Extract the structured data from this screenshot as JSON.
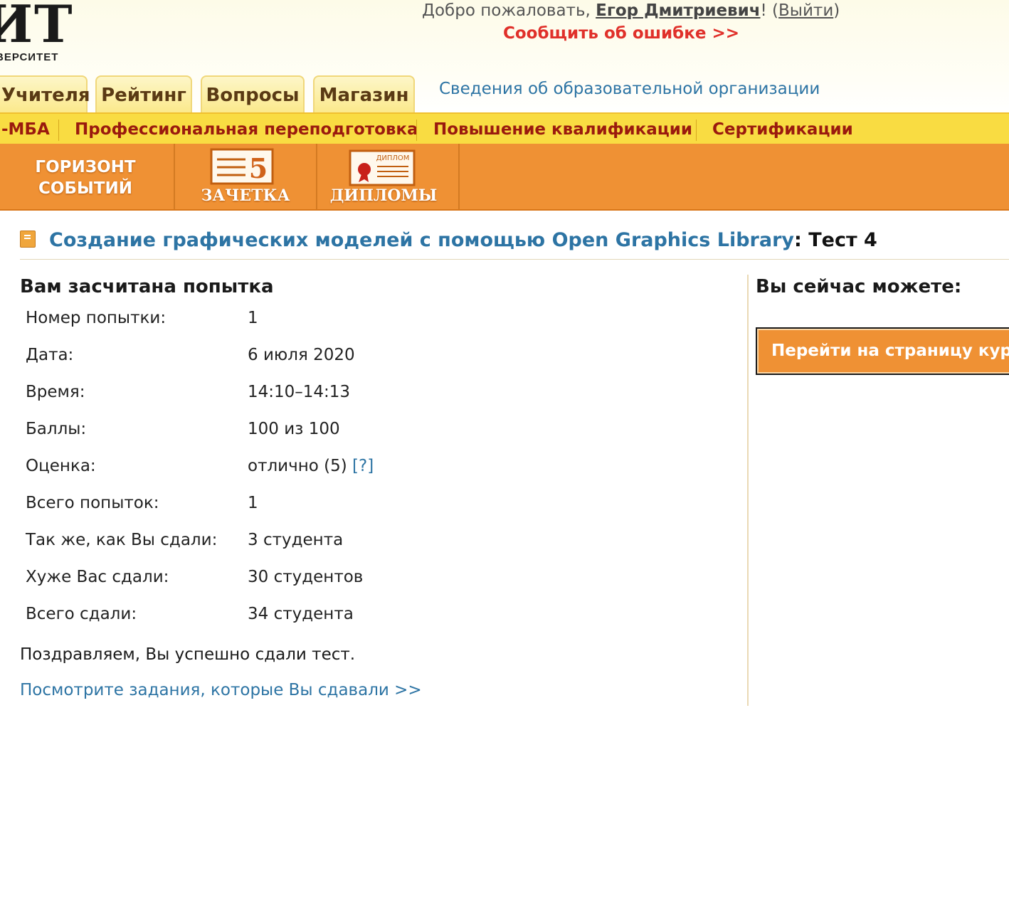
{
  "header": {
    "logo_big": "ИТ",
    "logo_small": "ВЕРСИТЕТ",
    "welcome_prefix": "Добро пожаловать, ",
    "user_name": "Егор Дмитриевич",
    "welcome_exclaim": "! (",
    "logout": "Выйти",
    "welcome_close": ")",
    "report_error": "Сообщить об ошибке >>"
  },
  "tabs": [
    "Учителя",
    "Рейтинг",
    "Вопросы",
    "Магазин"
  ],
  "org_info_link": "Сведения об образовательной организации",
  "yellow_menu": [
    "-МБА",
    "Профессиональная переподготовка",
    "Повышение квалификации",
    "Сертификации"
  ],
  "orange_menu": {
    "horizon_line1": "ГОРИЗОНТ",
    "horizon_line2": "СОБЫТИЙ",
    "zachetka": "ЗАЧЕТКА",
    "zachetka_grade": "5",
    "diplomas": "ДИПЛОМЫ",
    "diploma_tag": "ДИПЛОМ"
  },
  "page": {
    "course_title": "Создание графических моделей с помощью Open Graphics Library",
    "test_suffix": ": Тест 4"
  },
  "attempt": {
    "heading": "Вам засчитана попытка",
    "rows": [
      {
        "label": "Номер попытки:",
        "value": "1"
      },
      {
        "label": "Дата:",
        "value": "6 июля 2020"
      },
      {
        "label": "Время:",
        "value": "14:10–14:13"
      },
      {
        "label": "Баллы:",
        "value": "100 из 100"
      },
      {
        "label": "Оценка:",
        "value": "отлично (5) ",
        "help": "[?]"
      },
      {
        "label": "Всего попыток:",
        "value": "1"
      },
      {
        "label": "Так же, как Вы сдали:",
        "value": "3 студента"
      },
      {
        "label": "Хуже Вас сдали:",
        "value": "30 студентов"
      },
      {
        "label": "Всего сдали:",
        "value": "34 студента"
      }
    ],
    "congrats": "Поздравляем, Вы успешно сдали тест.",
    "see_tasks": "Посмотрите задания, которые Вы сдавали >>"
  },
  "sidebar": {
    "heading": "Вы сейчас можете:",
    "course_button": "Перейти на страницу курса"
  }
}
